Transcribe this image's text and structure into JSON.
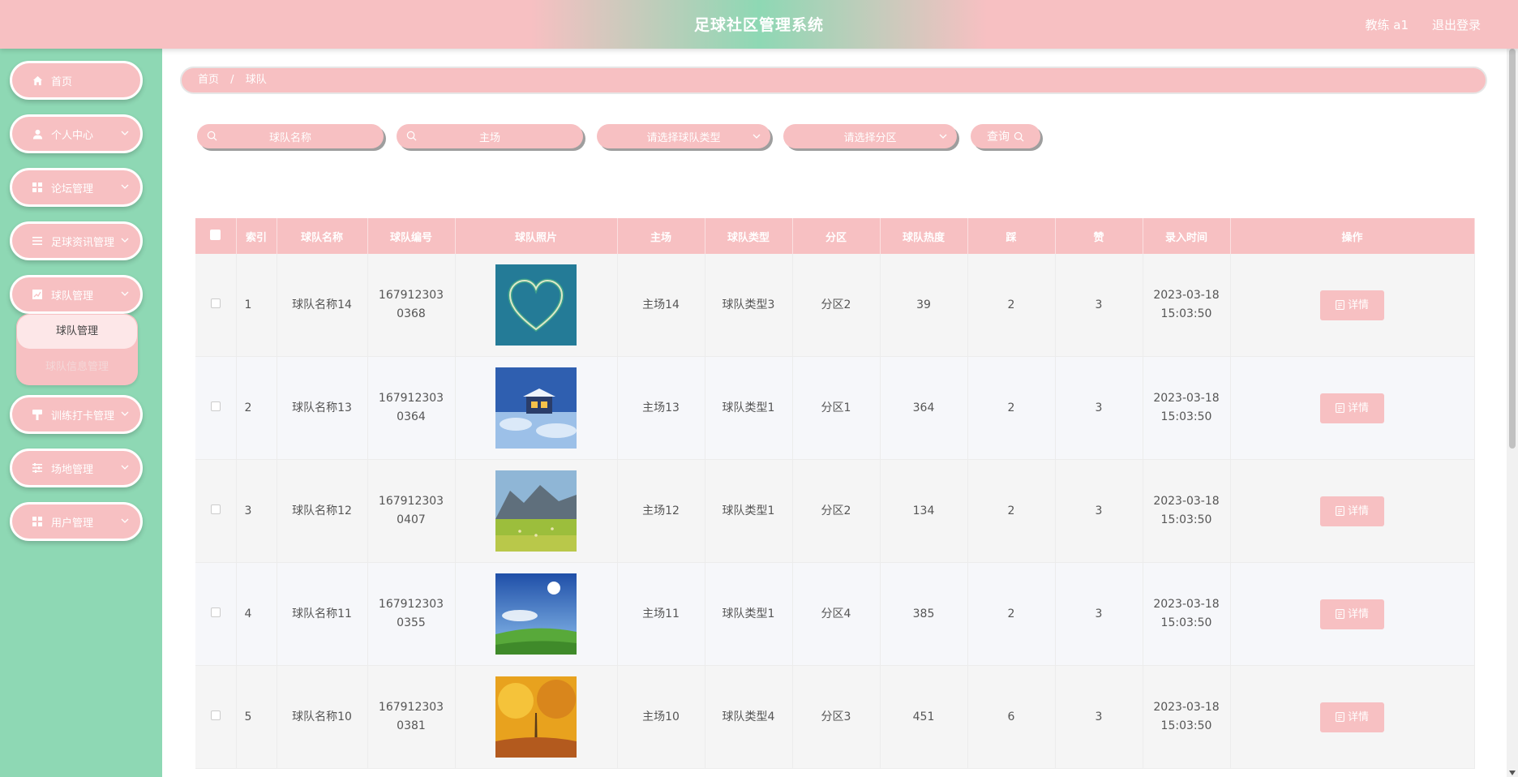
{
  "header": {
    "title": "足球社区管理系统",
    "user": "教练 a1",
    "logout": "退出登录"
  },
  "sidebar": {
    "items": [
      {
        "label": "首页",
        "icon": "home-icon"
      },
      {
        "label": "个人中心",
        "icon": "user-icon"
      },
      {
        "label": "论坛管理",
        "icon": "grid-icon"
      },
      {
        "label": "足球资讯管理",
        "icon": "list-icon"
      },
      {
        "label": "球队管理",
        "icon": "chart-icon"
      },
      {
        "label": "训练打卡管理",
        "icon": "brush-icon"
      },
      {
        "label": "场地管理",
        "icon": "sliders-icon"
      },
      {
        "label": "用户管理",
        "icon": "grid-icon"
      }
    ],
    "submenu": {
      "active": "球队管理",
      "other": "球队信息管理"
    }
  },
  "breadcrumb": {
    "home": "首页",
    "sep": "/",
    "current": "球队"
  },
  "search": {
    "team_name_placeholder": "球队名称",
    "home_placeholder": "主场",
    "type_placeholder": "请选择球队类型",
    "zone_placeholder": "请选择分区",
    "query_label": "查询"
  },
  "table": {
    "headers": [
      "索引",
      "球队名称",
      "球队编号",
      "球队照片",
      "主场",
      "球队类型",
      "分区",
      "球队热度",
      "踩",
      "赞",
      "录入时间",
      "操作"
    ],
    "detail_label": "详情",
    "rows": [
      {
        "index": "1",
        "name": "球队名称14",
        "code": "1679123030368",
        "home": "主场14",
        "type": "球队类型3",
        "zone": "分区2",
        "heat": "39",
        "dislike": "2",
        "like": "3",
        "date": "2023-03-18",
        "time": "15:03:50",
        "photo": "heart-island"
      },
      {
        "index": "2",
        "name": "球队名称13",
        "code": "1679123030364",
        "home": "主场13",
        "type": "球队类型1",
        "zone": "分区1",
        "heat": "364",
        "dislike": "2",
        "like": "3",
        "date": "2023-03-18",
        "time": "15:03:50",
        "photo": "snow-cabin"
      },
      {
        "index": "3",
        "name": "球队名称12",
        "code": "1679123030407",
        "home": "主场12",
        "type": "球队类型1",
        "zone": "分区2",
        "heat": "134",
        "dislike": "2",
        "like": "3",
        "date": "2023-03-18",
        "time": "15:03:50",
        "photo": "mountain-meadow"
      },
      {
        "index": "4",
        "name": "球队名称11",
        "code": "1679123030355",
        "home": "主场11",
        "type": "球队类型1",
        "zone": "分区4",
        "heat": "385",
        "dislike": "2",
        "like": "3",
        "date": "2023-03-18",
        "time": "15:03:50",
        "photo": "sunny-field"
      },
      {
        "index": "5",
        "name": "球队名称10",
        "code": "1679123030381",
        "home": "主场10",
        "type": "球队类型4",
        "zone": "分区3",
        "heat": "451",
        "dislike": "6",
        "like": "3",
        "date": "2023-03-18",
        "time": "15:03:50",
        "photo": "autumn-trees"
      }
    ]
  },
  "colors": {
    "pink": "#f7c0c2",
    "mint": "#8ed8b4",
    "white": "#ffffff"
  }
}
